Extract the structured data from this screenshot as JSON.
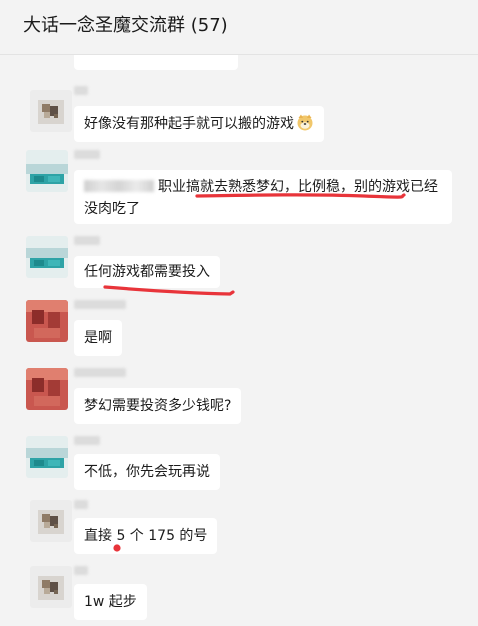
{
  "window": {
    "title": "大话一念圣魔交流群 (57)"
  },
  "messages": [
    {
      "sender": "user-a",
      "text": "好像没有那种起手就可以搬的游戏"
    },
    {
      "sender": "user-b",
      "text_after_name": "职业搞就去熟悉梦幻，比例稳，别的游戏已经没肉吃了"
    },
    {
      "sender": "user-b",
      "text": "任何游戏都需要投入"
    },
    {
      "sender": "user-c",
      "text": "是啊"
    },
    {
      "sender": "user-c",
      "text": "梦幻需要投资多少钱呢?"
    },
    {
      "sender": "user-b",
      "text": "不低，你先会玩再说"
    },
    {
      "sender": "user-a",
      "text": "直接 5 个 175 的号"
    },
    {
      "sender": "user-a",
      "text": "1w 起步"
    }
  ],
  "icons": {
    "emoji": "doge-emoji-icon",
    "annotation": "red-pen-underline"
  },
  "colors": {
    "background": "#f3f3f3",
    "bubble": "#ffffff",
    "annotation": "#e8343a"
  }
}
